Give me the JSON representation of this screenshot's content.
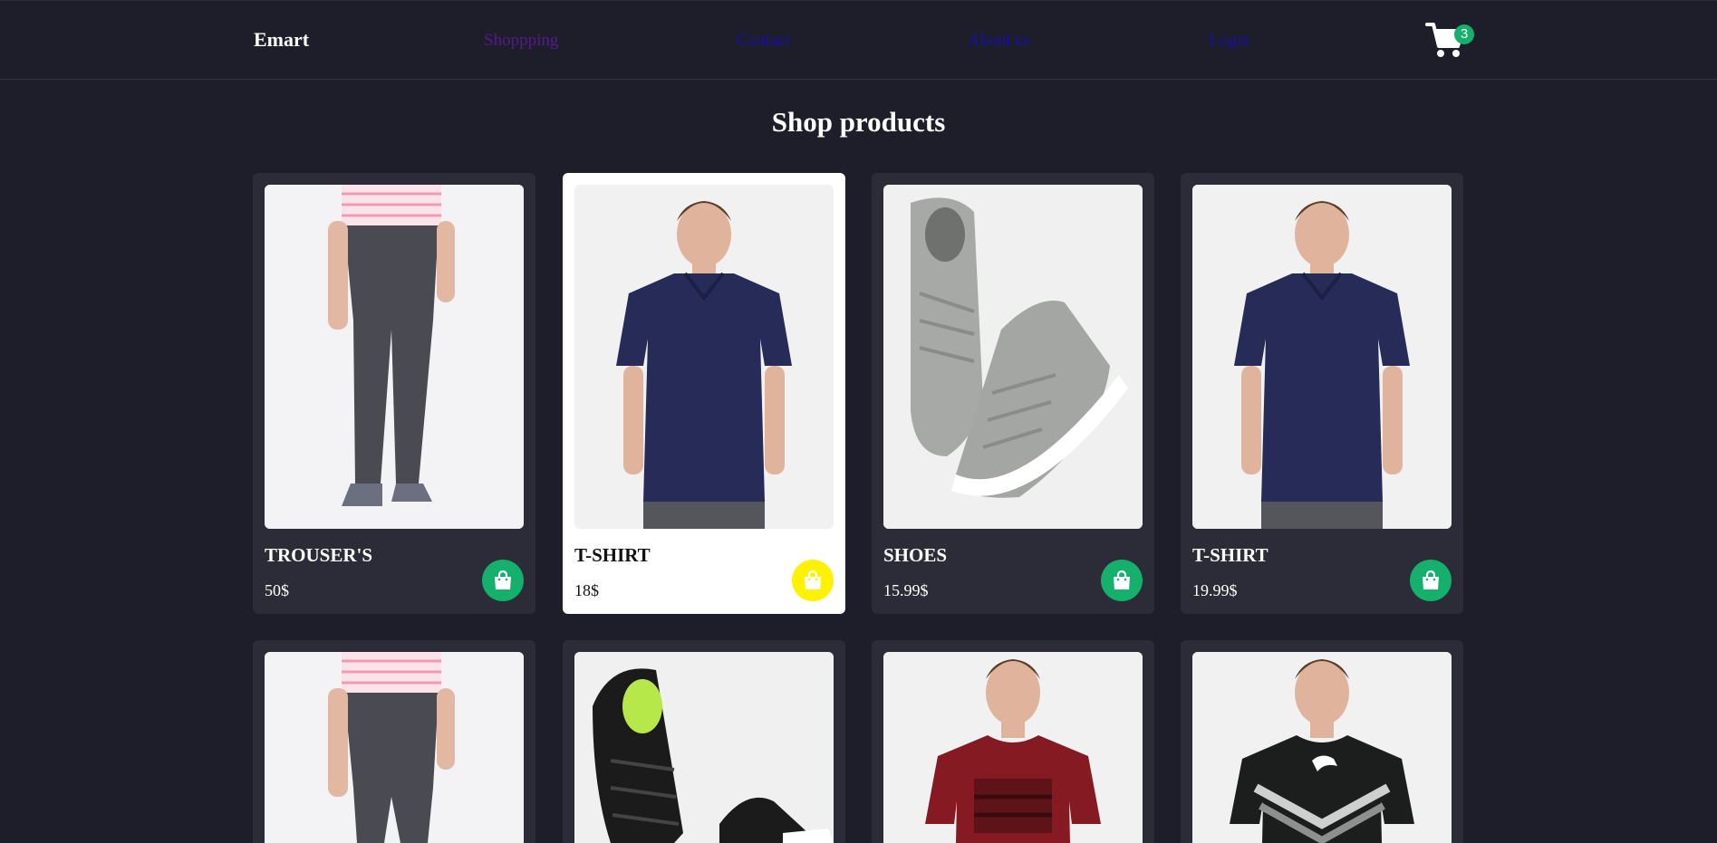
{
  "header": {
    "brand": "Emart",
    "nav": [
      {
        "label": "Shoppping",
        "state": "visited"
      },
      {
        "label": "Contact",
        "state": "unvisited"
      },
      {
        "label": "About us",
        "state": "unvisited"
      },
      {
        "label": "Login",
        "state": "unvisited"
      }
    ],
    "cart_count": "3"
  },
  "page_title": "Shop products",
  "colors": {
    "background": "#1e1e2b",
    "card": "#2c2c38",
    "bag_button": "#15b06b",
    "bag_button_active": "#fff200"
  },
  "products": [
    {
      "name": "TROUSER'S",
      "price": "50$",
      "image": "trousers-photo"
    },
    {
      "name": "T-SHIRT",
      "price": "18$",
      "image": "navy-polo-photo",
      "highlighted": true
    },
    {
      "name": "SHOES",
      "price": "15.99$",
      "image": "grey-sneakers-photo"
    },
    {
      "name": "T-SHIRT",
      "price": "19.99$",
      "image": "navy-polo-photo"
    },
    {
      "name": "",
      "price": "",
      "image": "trousers-photo"
    },
    {
      "name": "",
      "price": "",
      "image": "black-sneakers-photo"
    },
    {
      "name": "",
      "price": "",
      "image": "red-tshirt-photo"
    },
    {
      "name": "",
      "price": "",
      "image": "black-puma-tshirt-photo"
    }
  ]
}
